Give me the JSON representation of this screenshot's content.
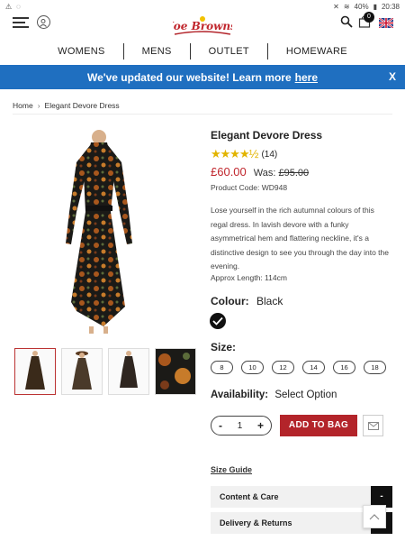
{
  "statusbar": {
    "battery": "40%",
    "time": "20:38"
  },
  "header": {
    "logo_text": "Joe Browns",
    "cart_count": "0"
  },
  "nav": {
    "items": [
      "WOMENS",
      "MENS",
      "OUTLET",
      "HOMEWARE"
    ]
  },
  "banner": {
    "text": "We've updated our website! Learn more",
    "link": "here",
    "close": "X",
    "color": "#1f6fc0"
  },
  "breadcrumb": {
    "home": "Home",
    "current": "Elegant Devore Dress"
  },
  "product": {
    "title": "Elegant Devore Dress",
    "rating": 4.5,
    "review_count": "(14)",
    "price_now": "£60.00",
    "was_label": "Was:",
    "price_was": "£95.00",
    "code": "Product Code: WD948",
    "description": "Lose yourself in the rich autumnal colours of this regal dress. In lavish devore with a funky asymmetrical hem and flattering neckline, it's a distinctive design to see you through the day into the evening.",
    "approx_length": "Approx Length: 114cm",
    "colour_label": "Colour:",
    "colour_value": "Black",
    "size_label": "Size:",
    "sizes": [
      "8",
      "10",
      "12",
      "14",
      "16",
      "18"
    ],
    "availability_label": "Availability:",
    "availability_value": "Select Option",
    "quantity": "1",
    "minus": "-",
    "plus": "+",
    "add_to_bag": "ADD TO BAG",
    "size_guide": "Size Guide",
    "accordions": [
      {
        "label": "Content & Care",
        "toggle": "-"
      },
      {
        "label": "Delivery & Returns",
        "toggle": "-"
      }
    ]
  },
  "colors": {
    "price": "#c0262d",
    "add_bag": "#b3242a",
    "star": "#e2b400"
  }
}
